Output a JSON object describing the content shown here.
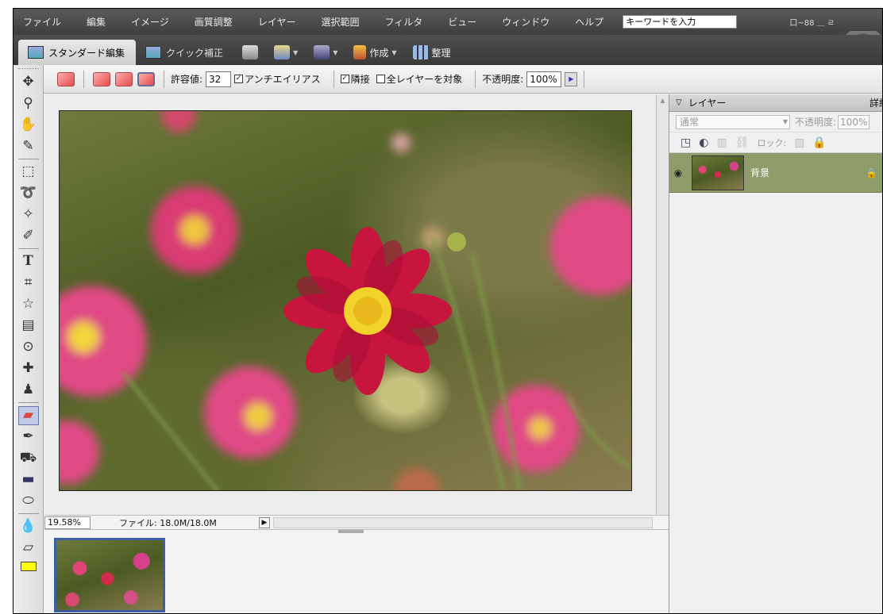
{
  "menu": {
    "items": [
      "ファイル",
      "編集",
      "イメージ",
      "画質調整",
      "レイヤー",
      "選択範囲",
      "フィルタ",
      "ビュー",
      "ウィンドウ",
      "ヘルプ"
    ],
    "search_value": "キーワードを入力",
    "window_buttons": "口~88 ＿ ㄹ"
  },
  "tabs": {
    "standard": "スタンダード編集",
    "quick": "クイック補正"
  },
  "toolbar": {
    "create": "作成",
    "organize": "整理"
  },
  "options": {
    "tolerance_label": "許容値:",
    "tolerance_value": "32",
    "antialias": "アンチエイリアス",
    "contiguous": "隣接",
    "all_layers": "全レイヤーを対象",
    "opacity_label": "不透明度:",
    "opacity_value": "100%"
  },
  "status": {
    "zoom": "19.58%",
    "file_info": "ファイル: 18.0M/18.0M"
  },
  "layers_panel": {
    "title": "レイヤー",
    "more": "詳細",
    "blend_mode": "通常",
    "opacity_label": "不透明度:",
    "opacity_value": "100%",
    "lock_label": "ロック:",
    "layers": [
      {
        "name": "背景"
      }
    ]
  },
  "colors": {
    "menu_bg": "#4a4a4a",
    "active_layer": "#8e9c6a",
    "selection_border": "#3b5fa0"
  }
}
